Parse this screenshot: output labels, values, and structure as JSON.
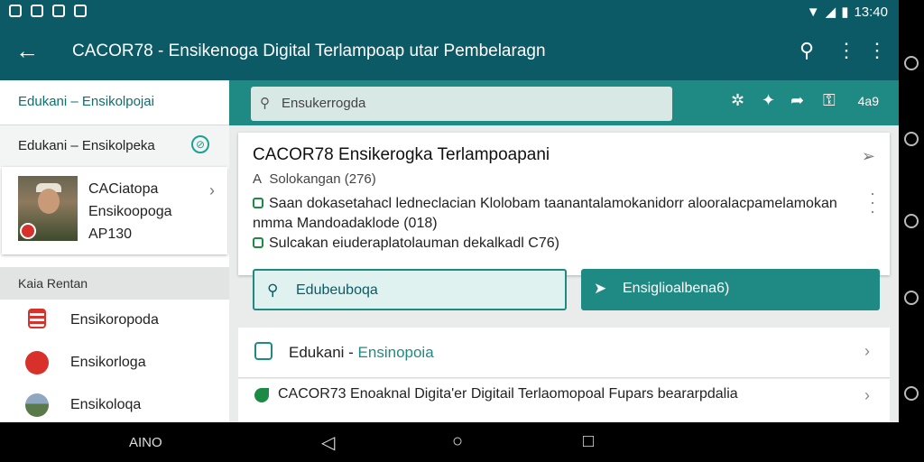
{
  "status_bar": {
    "time": "13:40"
  },
  "app_bar": {
    "back_icon": "arrow-left-icon",
    "title": "CACOR78 - Ensikenoga Digital Terlampoap utar Pembelaragn",
    "actions": [
      "search-icon",
      "more-vert-icon",
      "more-vert-icon"
    ]
  },
  "sidebar": {
    "header": "Edukani – Ensikolpojai",
    "section_title": "Edukani – Ensikolpeka",
    "card": {
      "line1": "CACiatopa",
      "line2": "Ensikoopoga",
      "line3": "AP130"
    },
    "subheader": "Kaia Rentan",
    "items": [
      {
        "label": "Ensikoropoda",
        "icon": "shield-flag-icon",
        "color": "#d8302b"
      },
      {
        "label": "Ensikorloga",
        "icon": "app-logo-icon",
        "color": "#d8302b"
      },
      {
        "label": "Ensikoloqa",
        "icon": "landscape-thumbnail-icon",
        "color": "#5a7a4a"
      }
    ]
  },
  "toolbar": {
    "search_placeholder": "Ensukerrogda",
    "count": "4a9"
  },
  "content": {
    "title": "CACOR78 Ensikerogka Terlampoapani",
    "subtitle": "Solokangan (276)",
    "line1": "Saan dokasetahacl ledneclacian Klolobam taanantalamokanidorr alooralacpamelamokan",
    "line2": "nmma Mandoadaklode (018)",
    "line3": "Sulcakan eiuderaplatolauman dekalkadl C76)"
  },
  "buttons": {
    "outline_label": "Edubeuboqa",
    "filled_label": "Ensiglioalbena6)"
  },
  "list": {
    "row1_prefix": "Edukani - ",
    "row1_accent": "Ensinopoia",
    "row2_label": "CACOR73 Enoaknal Digita'er Digitail Terlaomopoal Fupars beararpdalia"
  },
  "nav_bar": {
    "label": "AINO"
  },
  "colors": {
    "primary": "#0d5a67",
    "accent": "#1f8a83",
    "green": "#1b8a45",
    "red": "#d8302b"
  }
}
